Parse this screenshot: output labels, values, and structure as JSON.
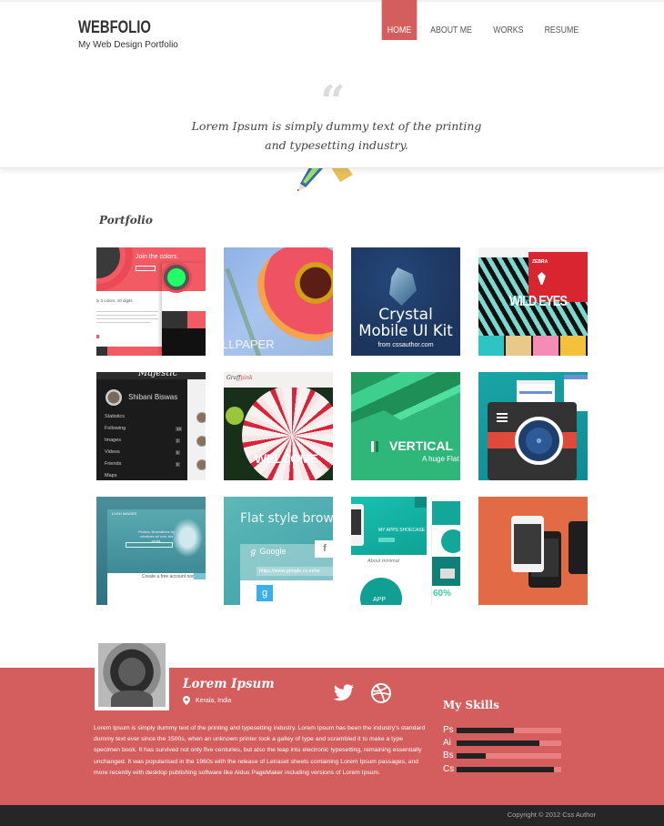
{
  "header": {
    "logo_title": "WEBFOLIO",
    "logo_subtitle": "My Web Design Portfolio",
    "nav": [
      {
        "label": "HOME",
        "active": true
      },
      {
        "label": "ABOUT ME",
        "active": false
      },
      {
        "label": "WORKS",
        "active": false
      },
      {
        "label": "RESUME",
        "active": false
      }
    ],
    "quote_icon": "quote-icon",
    "quote": "Lorem Ipsum is simply dummy text of the printing and typesetting industry."
  },
  "portfolio": {
    "title": "Portfolio",
    "tiles": [
      {
        "name": "join-the-colors",
        "caption": "Join the colors.",
        "subcaption": "ly 3 colors, 10 digits"
      },
      {
        "name": "flower-wallpaper",
        "caption": "LLPAPER"
      },
      {
        "name": "crystal-mobile-ui-kit",
        "caption_line1": "Crystal",
        "caption_line2": "Mobile UI Kit",
        "subcaption": "from cssauthor.com"
      },
      {
        "name": "zebra-wild-eyes",
        "brand": "ZEBRA",
        "caption": "WILD EYES"
      },
      {
        "name": "majestic-profile",
        "title": "Majestic",
        "user": "Shibani Biswas",
        "menu": [
          {
            "label": "Statistics",
            "count": ""
          },
          {
            "label": "Following",
            "count": "10"
          },
          {
            "label": "Images",
            "count": "2"
          },
          {
            "label": "Videos",
            "count": "5"
          },
          {
            "label": "Friends",
            "count": "5"
          },
          {
            "label": "Maps",
            "count": ""
          }
        ]
      },
      {
        "name": "graff-pink-welcome",
        "brand_a": "Graff",
        "brand_b": "pink",
        "caption": "WELCOME"
      },
      {
        "name": "vertical-flat",
        "caption": "VERTICAL",
        "subcaption": "A huge Flat"
      },
      {
        "name": "camera-app-icon"
      },
      {
        "name": "lush-images",
        "brand": "LUSH IMAGES",
        "hero_text": "Photos, illustrations by creatives all over the world.",
        "cta": "Create a free account now"
      },
      {
        "name": "flat-style-browser",
        "caption": "Flat style browse",
        "google": "Google",
        "url": "https://www.google.co.in/se",
        "fb": "f",
        "g": "g"
      },
      {
        "name": "my-apps-showcase",
        "caption": "MY APPS SHOECASE",
        "about": "About minimal",
        "app": "APP",
        "percent": "60%"
      },
      {
        "name": "flat-phones"
      }
    ]
  },
  "profile": {
    "name": "Lorem Ipsum",
    "location": "Kerala, India",
    "social": [
      "twitter-icon",
      "dribbble-icon"
    ],
    "bio": "Lorem Ipsum is simply dummy text of the printing and typesetting industry. Lorem Ipsum has been the industry's standard dummy text ever since the 1500s, when an unknown printer took a galley of type and scrambled it to make a type specimen book. It has survived not only five centuries, but also the leap into electronic typesetting, remaining essentially unchanged. It was popularised in the 1960s with the release of Letraset sheets containing Lorem Ipsum passages, and more recently with desktop publishing software like Aldus PageMaker including versions of Lorem Ipsum.",
    "skills_title": "My Skills",
    "skills": [
      {
        "label": "Ps",
        "percent": 55
      },
      {
        "label": "Ai",
        "percent": 79
      },
      {
        "label": "Bs",
        "percent": 28
      },
      {
        "label": "Cs",
        "percent": 93
      }
    ]
  },
  "footer": {
    "copyright": "Copyright © 2012 Css Author"
  },
  "colors": {
    "accent": "#d45d5d",
    "footer": "#262626",
    "skill_track": "#e7807f",
    "skill_fill": "#222222"
  }
}
